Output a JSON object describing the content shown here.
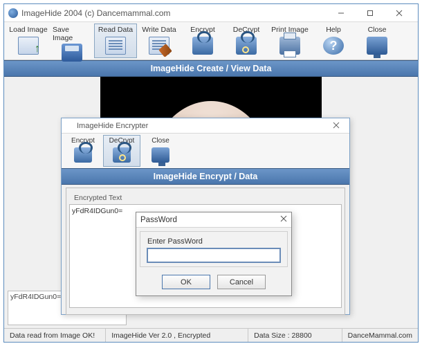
{
  "main": {
    "title": "ImageHide 2004 (c) Dancemammal.com",
    "banner": "ImageHide Create / View Data",
    "toolbar": [
      {
        "label": "Load Image",
        "icon": "load-image-icon"
      },
      {
        "label": "Save Image",
        "icon": "save-disk-icon"
      },
      {
        "label": "Read Data",
        "icon": "read-doc-icon",
        "selected": true
      },
      {
        "label": "Write Data",
        "icon": "write-doc-icon"
      },
      {
        "label": "Encrypt",
        "icon": "lock-icon"
      },
      {
        "label": "DeCrypt",
        "icon": "unlock-icon"
      },
      {
        "label": "Print Image",
        "icon": "printer-icon"
      },
      {
        "label": "Help",
        "icon": "help-icon"
      },
      {
        "label": "Close",
        "icon": "monitor-icon"
      }
    ],
    "bottom_text": "yFdR4IDGun0=",
    "status": {
      "read_ok": "Data read from Image OK!",
      "version": "ImageHide Ver 2.0 , Encrypted",
      "data_size": "Data Size : 28800",
      "brand": "DanceMammal.com"
    }
  },
  "encrypter": {
    "title": "ImageHide Encrypter",
    "banner": "ImageHide Encrypt / Data",
    "toolbar": [
      {
        "label": "Encrypt",
        "icon": "lock-icon"
      },
      {
        "label": "DeCrypt",
        "icon": "unlock-icon",
        "selected": true
      },
      {
        "label": "Close",
        "icon": "monitor-icon"
      }
    ],
    "fieldset_label": "Encrypted Text",
    "text_value": "yFdR4IDGun0="
  },
  "password_dialog": {
    "title": "PassWord",
    "label": "Enter PassWord",
    "value": "",
    "ok": "OK",
    "cancel": "Cancel"
  }
}
